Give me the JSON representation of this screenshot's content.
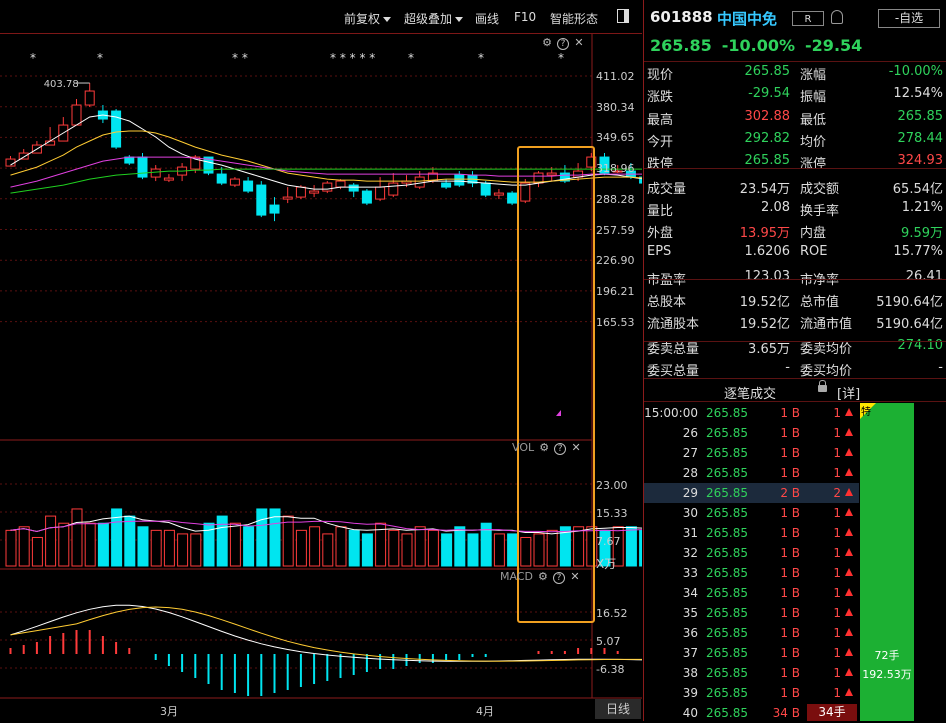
{
  "toolbar": {
    "fuquan": "前复权",
    "overlay": "超级叠加",
    "draw": "画线",
    "f10": "F10",
    "smart": "智能形态"
  },
  "main_chart": {
    "high_label": "403.78",
    "y_ticks": [
      "411.02",
      "380.34",
      "349.65",
      "318.96",
      "288.28",
      "257.59",
      "226.90",
      "196.21",
      "165.53"
    ],
    "y_tick_values": [
      411.02,
      380.34,
      349.65,
      318.96,
      288.28,
      257.59,
      226.9,
      196.21,
      165.53
    ],
    "stars": [
      "*",
      "*",
      "* *",
      "* * * * *",
      "*",
      "*",
      "*"
    ],
    "vol_label": "VOL",
    "vol_ticks": [
      "23.00",
      "15.33",
      "7.67"
    ],
    "vol_unit": "X万",
    "macd_label": "MACD",
    "macd_ticks": [
      "16.52",
      "5.07",
      "-6.38"
    ],
    "x_labels": [
      "3月",
      "4月"
    ],
    "period": "日线",
    "candles": [
      [
        321,
        328,
        326,
        331
      ],
      [
        328,
        334,
        330,
        338
      ],
      [
        334,
        342,
        338,
        346
      ],
      [
        342,
        346,
        346,
        360
      ],
      [
        346,
        362,
        352,
        370
      ],
      [
        362,
        382,
        364,
        388
      ],
      [
        382,
        396,
        380,
        404
      ],
      [
        376,
        368,
        364,
        382
      ],
      [
        376,
        340,
        338,
        378
      ],
      [
        330,
        324,
        322,
        332
      ],
      [
        330,
        310,
        308,
        334
      ],
      [
        310,
        318,
        306,
        322
      ],
      [
        307,
        309,
        305,
        313
      ],
      [
        312,
        320,
        306,
        324
      ],
      [
        318,
        330,
        314,
        332
      ],
      [
        330,
        314,
        312,
        330
      ],
      [
        313,
        304,
        302,
        320
      ],
      [
        302,
        308,
        300,
        310
      ],
      [
        306,
        296,
        294,
        310
      ],
      [
        302,
        272,
        270,
        306
      ],
      [
        282,
        274,
        266,
        290
      ],
      [
        288,
        290,
        284,
        300
      ],
      [
        290,
        300,
        288,
        302
      ],
      [
        294,
        296,
        290,
        302
      ],
      [
        296,
        304,
        294,
        306
      ],
      [
        300,
        306,
        298,
        308
      ],
      [
        302,
        296,
        290,
        304
      ],
      [
        296,
        284,
        282,
        298
      ],
      [
        288,
        300,
        286,
        310
      ],
      [
        292,
        304,
        290,
        314
      ],
      [
        304,
        306,
        300,
        312
      ],
      [
        300,
        310,
        298,
        316
      ],
      [
        306,
        314,
        304,
        320
      ],
      [
        304,
        300,
        298,
        308
      ],
      [
        312,
        302,
        300,
        316
      ],
      [
        312,
        304,
        300,
        316
      ],
      [
        304,
        292,
        290,
        306
      ],
      [
        292,
        294,
        288,
        298
      ],
      [
        294,
        284,
        282,
        296
      ],
      [
        286,
        304,
        284,
        308
      ],
      [
        304,
        314,
        300,
        316
      ],
      [
        312,
        314,
        306,
        320
      ],
      [
        314,
        306,
        304,
        322
      ],
      [
        310,
        316,
        306,
        324
      ],
      [
        320,
        330,
        316,
        334
      ],
      [
        330,
        314,
        312,
        334
      ],
      [
        316,
        316,
        314,
        322
      ],
      [
        316,
        310,
        308,
        324
      ],
      [
        310,
        304,
        304,
        318
      ],
      [
        304,
        292,
        288,
        306
      ],
      [
        292,
        266,
        264,
        292
      ]
    ],
    "ma": [
      [
        322,
        330,
        338,
        346,
        354,
        362,
        370,
        372,
        370,
        366,
        358,
        350,
        340,
        333,
        328,
        325,
        322,
        318,
        314,
        310,
        306,
        302,
        300,
        298,
        298,
        300,
        300,
        300,
        300,
        301,
        302,
        304,
        306,
        306,
        306,
        305,
        304,
        303,
        302,
        302,
        304,
        306,
        308,
        310,
        312,
        313,
        312,
        310,
        308,
        305,
        300
      ],
      [
        312,
        316,
        320,
        326,
        332,
        340,
        346,
        352,
        355,
        356,
        356,
        354,
        350,
        345,
        340,
        336,
        332,
        329,
        326,
        322,
        318,
        314,
        312,
        310,
        308,
        307,
        307,
        306,
        306,
        306,
        306,
        306,
        307,
        308,
        308,
        308,
        307,
        306,
        305,
        305,
        305,
        306,
        307,
        308,
        309,
        310,
        310,
        310,
        309,
        308,
        306
      ],
      [
        300,
        303,
        306,
        310,
        314,
        318,
        322,
        326,
        328,
        330,
        330,
        330,
        330,
        330,
        329,
        328,
        326,
        324,
        322,
        320,
        318,
        316,
        315,
        314,
        313,
        313,
        313,
        313,
        313,
        313,
        313,
        313,
        313,
        313,
        313,
        312,
        312,
        311,
        311,
        311,
        311,
        311,
        312,
        312,
        313,
        313,
        313,
        313,
        313,
        312,
        311
      ],
      [
        294,
        296,
        298,
        300,
        302,
        305,
        308,
        310,
        312,
        313,
        314,
        315,
        316,
        316,
        317,
        317,
        318,
        318,
        318,
        318,
        318,
        318,
        318,
        318,
        318,
        318,
        318,
        318,
        318,
        318,
        318,
        318,
        318,
        318,
        318,
        318,
        318,
        318,
        318,
        318,
        318,
        318,
        318,
        318,
        318,
        318,
        318,
        318,
        318,
        317,
        317
      ]
    ],
    "volume": [
      10,
      11,
      8,
      14,
      12,
      16,
      12,
      12,
      16,
      14,
      11,
      10,
      10,
      9,
      9,
      12,
      14,
      12,
      11,
      16,
      16,
      14,
      10,
      11,
      9,
      11,
      10,
      9,
      12,
      10,
      9,
      11,
      10,
      9,
      11,
      9,
      12,
      9,
      9,
      8,
      9,
      10,
      11,
      11,
      11,
      10,
      11,
      11,
      10,
      15,
      24
    ],
    "macd_hist": [
      2,
      3,
      4,
      6,
      7,
      8,
      8,
      6,
      4,
      2,
      0,
      -2,
      -4,
      -6,
      -8,
      -10,
      -12,
      -13,
      -14,
      -14,
      -13,
      -12,
      -11,
      -10,
      -9,
      -8,
      -7,
      -6,
      -5,
      -5,
      -4,
      -3,
      -3,
      -2,
      -2,
      -1,
      -1,
      0,
      0,
      0,
      1,
      1,
      1,
      2,
      2,
      2,
      1,
      0,
      -1,
      -3,
      -6
    ]
  },
  "quote": {
    "code": "601888",
    "name": "中国中免",
    "badge": "R",
    "watch": "-自选",
    "price": "265.85",
    "pct": "-10.00%",
    "change": "-29.54",
    "rows": [
      {
        "l1": "现价",
        "v1": "265.85",
        "c1": "g",
        "l2": "涨幅",
        "v2": "-10.00%",
        "c2": "g"
      },
      {
        "l1": "涨跌",
        "v1": "-29.54",
        "c1": "g",
        "l2": "振幅",
        "v2": "12.54%",
        "c2": "w"
      },
      {
        "l1": "最高",
        "v1": "302.88",
        "c1": "r",
        "l2": "最低",
        "v2": "265.85",
        "c2": "g"
      },
      {
        "l1": "今开",
        "v1": "292.82",
        "c1": "g",
        "l2": "均价",
        "v2": "278.44",
        "c2": "g"
      },
      {
        "l1": "跌停",
        "v1": "265.85",
        "c1": "g",
        "l2": "涨停",
        "v2": "324.93",
        "c2": "r"
      },
      {
        "l1": "成交量",
        "v1": "23.54万",
        "c1": "w",
        "l2": "成交额",
        "v2": "65.54亿",
        "c2": "w"
      },
      {
        "l1": "量比",
        "v1": "2.08",
        "c1": "w",
        "l2": "换手率",
        "v2": "1.21%",
        "c2": "w"
      },
      {
        "l1": "外盘",
        "v1": "13.95万",
        "c1": "r",
        "l2": "内盘",
        "v2": "9.59万",
        "c2": "g"
      },
      {
        "l1": "EPS",
        "v1": "1.6206",
        "c1": "w",
        "l2": "ROE",
        "v2": "15.77%",
        "c2": "w"
      },
      {
        "l1": "市盈率",
        "v1": "123.03",
        "c1": "w",
        "l2": "市净率",
        "v2": "26.41",
        "c2": "w"
      },
      {
        "l1": "总股本",
        "v1": "19.52亿",
        "c1": "w",
        "l2": "总市值",
        "v2": "5190.64亿",
        "c2": "w"
      },
      {
        "l1": "流通股本",
        "v1": "19.52亿",
        "c1": "w",
        "l2": "流通市值",
        "v2": "5190.64亿",
        "c2": "w"
      },
      {
        "l1": "委卖总量",
        "v1": "3.65万",
        "c1": "w",
        "l2": "委卖均价",
        "v2": "274.10",
        "c2": "g"
      },
      {
        "l1": "委买总量",
        "v1": "-",
        "c1": "w",
        "l2": "委买均价",
        "v2": "-",
        "c2": "w"
      }
    ]
  },
  "ticks": {
    "title": "逐笔成交",
    "detail": "[详]",
    "te": "特",
    "bar_top": "72手",
    "bar_bottom": "192.53万",
    "last_vol": "34手",
    "rows": [
      {
        "t": "15:00:00",
        "p": "265.85",
        "v": "1 B",
        "n": "1"
      },
      {
        "t": "26",
        "p": "265.85",
        "v": "1 B",
        "n": "1"
      },
      {
        "t": "27",
        "p": "265.85",
        "v": "1 B",
        "n": "1"
      },
      {
        "t": "28",
        "p": "265.85",
        "v": "1 B",
        "n": "1"
      },
      {
        "t": "29",
        "p": "265.85",
        "v": "2 B",
        "n": "2"
      },
      {
        "t": "30",
        "p": "265.85",
        "v": "1 B",
        "n": "1"
      },
      {
        "t": "31",
        "p": "265.85",
        "v": "1 B",
        "n": "1"
      },
      {
        "t": "32",
        "p": "265.85",
        "v": "1 B",
        "n": "1"
      },
      {
        "t": "33",
        "p": "265.85",
        "v": "1 B",
        "n": "1"
      },
      {
        "t": "34",
        "p": "265.85",
        "v": "1 B",
        "n": "1"
      },
      {
        "t": "35",
        "p": "265.85",
        "v": "1 B",
        "n": "1"
      },
      {
        "t": "36",
        "p": "265.85",
        "v": "1 B",
        "n": "1"
      },
      {
        "t": "37",
        "p": "265.85",
        "v": "1 B",
        "n": "1"
      },
      {
        "t": "38",
        "p": "265.85",
        "v": "1 B",
        "n": "1"
      },
      {
        "t": "39",
        "p": "265.85",
        "v": "1 B",
        "n": "1"
      },
      {
        "t": "40",
        "p": "265.85",
        "v": "34 B",
        "n": ""
      }
    ]
  },
  "colors": {
    "up": "#ff3b3b",
    "down": "#00e5f0",
    "accent": "#f0a020"
  }
}
